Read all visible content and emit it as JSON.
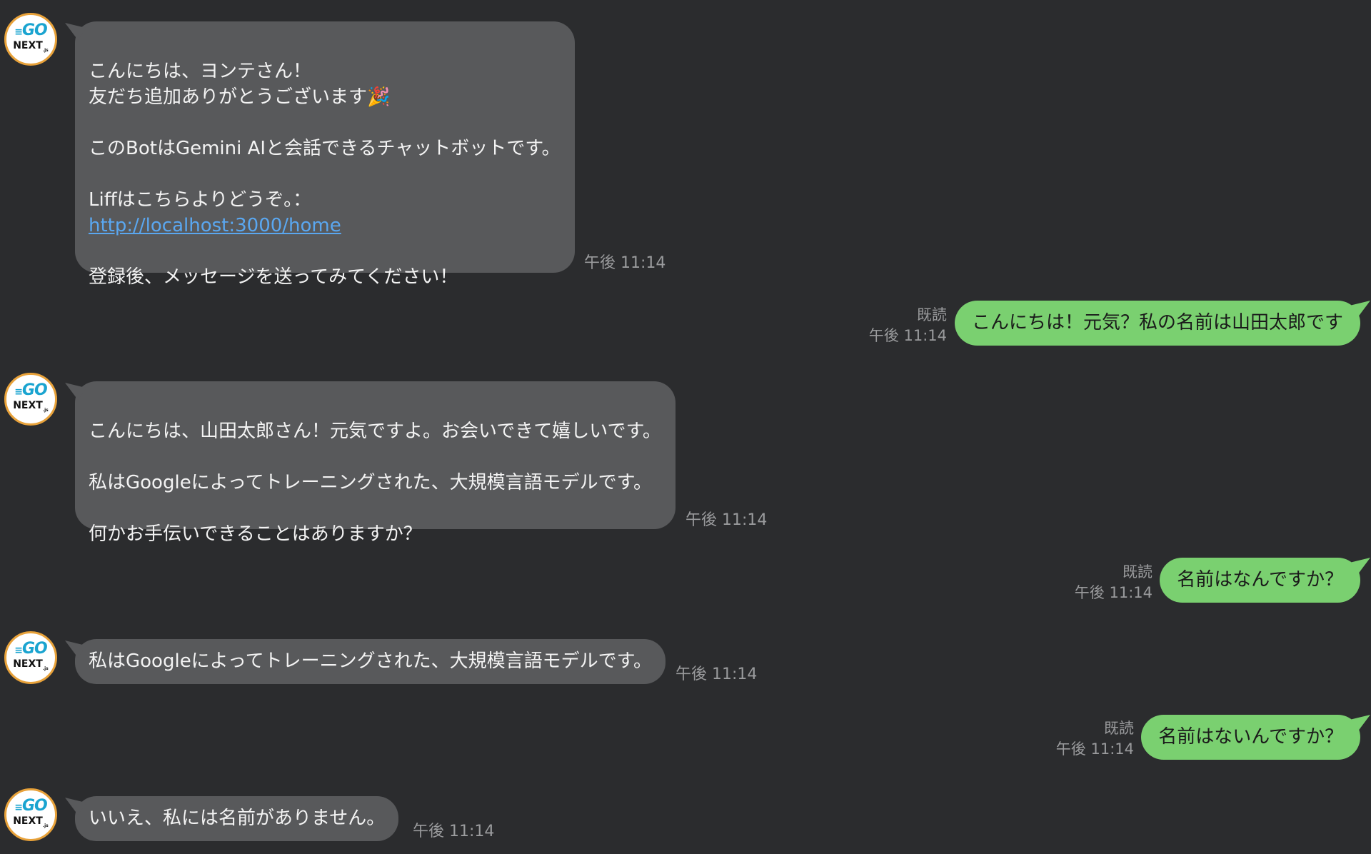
{
  "avatar": {
    "go_text": "GO",
    "next_text": "NEXT",
    "next_suffix": ".js"
  },
  "messages": [
    {
      "sender": "bot",
      "line1": "こんにちは、ヨンテさん！",
      "line2": "友だち追加ありがとうございます",
      "emoji": "🎉",
      "line3": "このBotはGemini AIと会話できるチャットボットです。",
      "line4": "Liffはこちらよりどうぞ。：",
      "link": "http://localhost:3000/home",
      "line5": "登録後、メッセージを送ってみてください！",
      "time": "午後 11:14"
    },
    {
      "sender": "user",
      "text": "こんにちは！元気？私の名前は山田太郎です",
      "read": "既読",
      "time": "午後 11:14"
    },
    {
      "sender": "bot",
      "line1": "こんにちは、山田太郎さん！元気ですよ。お会いできて嬉しいです。",
      "line2": "私はGoogleによってトレーニングされた、大規模言語モデルです。",
      "line3": "何かお手伝いできることはありますか？",
      "time": "午後 11:14"
    },
    {
      "sender": "user",
      "text": "名前はなんですか？",
      "read": "既読",
      "time": "午後 11:14"
    },
    {
      "sender": "bot",
      "text": "私はGoogleによってトレーニングされた、大規模言語モデルです。",
      "time": "午後 11:14"
    },
    {
      "sender": "user",
      "text": "名前はないんですか？",
      "read": "既読",
      "time": "午後 11:14"
    },
    {
      "sender": "bot",
      "text": "いいえ、私には名前がありません。",
      "time": "午後 11:14"
    }
  ],
  "colors": {
    "background": "#2b2c2e",
    "bot_bubble": "#58595b",
    "user_bubble": "#7ad070",
    "link": "#5aa7f0",
    "timestamp": "#9a9b9d",
    "avatar_border": "#e8a23a"
  }
}
